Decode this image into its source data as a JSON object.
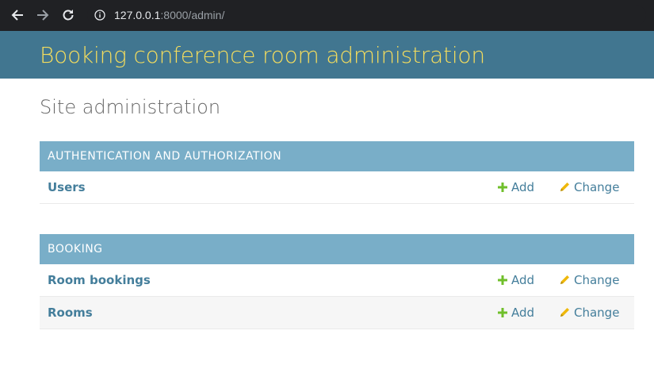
{
  "browser": {
    "url_host": "127.0.0.1",
    "url_rest": ":8000/admin/"
  },
  "header": {
    "site_name": "Booking conference room administration"
  },
  "page": {
    "title": "Site administration"
  },
  "modules": [
    {
      "caption": "AUTHENTICATION AND AUTHORIZATION",
      "rows": [
        {
          "model": "Users",
          "add": "Add",
          "change": "Change"
        }
      ]
    },
    {
      "caption": "BOOKING",
      "rows": [
        {
          "model": "Room bookings",
          "add": "Add",
          "change": "Change"
        },
        {
          "model": "Rooms",
          "add": "Add",
          "change": "Change"
        }
      ]
    }
  ],
  "colors": {
    "header_bg": "#417690",
    "site_name": "#f5dd5d",
    "caption_bg": "#79aec8",
    "link": "#447e9b",
    "add_icon": "#70bf2b",
    "change_icon": "#efb80b"
  },
  "icons": {
    "back": "arrow-left-icon",
    "forward": "arrow-right-icon",
    "reload": "reload-icon",
    "info": "info-icon",
    "add": "plus-icon",
    "change": "pencil-icon"
  }
}
